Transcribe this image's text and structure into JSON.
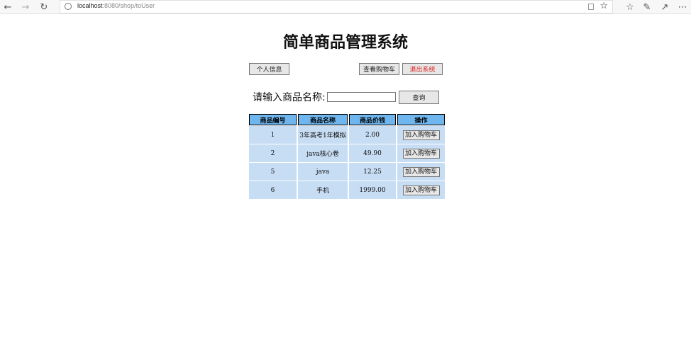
{
  "browser": {
    "url_host": "localhost",
    "url_rest": ":8080/shop/toUser"
  },
  "page": {
    "title": "简单商品管理系统",
    "buttons": {
      "profile": "个人信息",
      "view_cart": "查看购物车",
      "logout": "退出系统",
      "query": "查询"
    },
    "search_label": "请输入商品名称:",
    "search_value": ""
  },
  "table": {
    "headers": [
      "商品编号",
      "商品名称",
      "商品价钱",
      "操作"
    ],
    "rows": [
      {
        "id": "1",
        "name": "3年高考1年模拟",
        "price": "2.00",
        "action": "加入购物车"
      },
      {
        "id": "2",
        "name": "java核心卷",
        "price": "49.90",
        "action": "加入购物车"
      },
      {
        "id": "5",
        "name": "java",
        "price": "12.25",
        "action": "加入购物车"
      },
      {
        "id": "6",
        "name": "手机",
        "price": "1999.00",
        "action": "加入购物车"
      }
    ]
  },
  "colors": {
    "header_bg": "#6fb6ee",
    "cell_bg": "#c7ddf3",
    "logout_text": "#e02020"
  }
}
